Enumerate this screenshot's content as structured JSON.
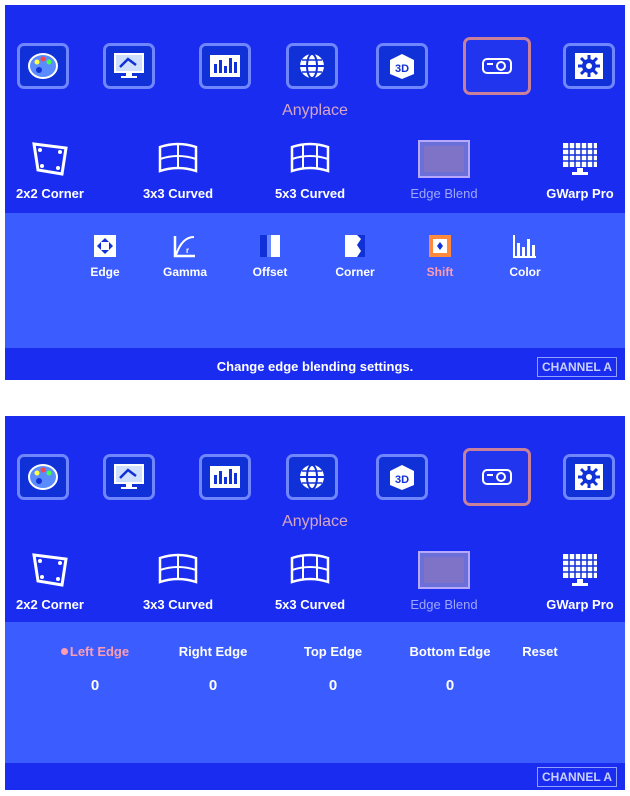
{
  "section_title": "Anyplace",
  "categories": [
    {
      "icon": "palette-icon"
    },
    {
      "icon": "display-settings-icon"
    },
    {
      "icon": "equalizer-icon"
    },
    {
      "icon": "globe-icon"
    },
    {
      "icon": "3d-icon"
    },
    {
      "icon": "projector-icon",
      "active": true
    },
    {
      "icon": "settings-gear-icon"
    }
  ],
  "modes": [
    {
      "label": "2x2 Corner",
      "icon": "corner-warp-icon"
    },
    {
      "label": "3x3 Curved",
      "icon": "curved-3x3-icon"
    },
    {
      "label": "5x3 Curved",
      "icon": "curved-5x3-icon"
    },
    {
      "label": "Edge Blend",
      "icon": "edge-blend-icon",
      "active": true
    },
    {
      "label": "GWarp Pro",
      "icon": "grid-monitor-icon"
    }
  ],
  "top_screen": {
    "submenu": [
      {
        "label": "Edge",
        "icon": "edge-arrows-icon"
      },
      {
        "label": "Gamma",
        "icon": "gamma-curve-icon"
      },
      {
        "label": "Offset",
        "icon": "offset-icon"
      },
      {
        "label": "Corner",
        "icon": "corner-icon"
      },
      {
        "label": "Shift",
        "icon": "shift-icon",
        "active": true
      },
      {
        "label": "Color",
        "icon": "color-bars-icon"
      }
    ],
    "status_text": "Change edge blending settings.",
    "channel": "CHANNEL A"
  },
  "bottom_screen": {
    "edges": [
      {
        "label": "Left Edge",
        "value": "0",
        "active": true
      },
      {
        "label": "Right Edge",
        "value": "0"
      },
      {
        "label": "Top Edge",
        "value": "0"
      },
      {
        "label": "Bottom Edge",
        "value": "0"
      },
      {
        "label": "Reset",
        "value": ""
      }
    ],
    "channel": "CHANNEL A"
  },
  "colors": {
    "background": "#1a2cf0",
    "panel": "#3b5dff",
    "active_text": "#ff9db0",
    "active_border": "#c9809a"
  }
}
